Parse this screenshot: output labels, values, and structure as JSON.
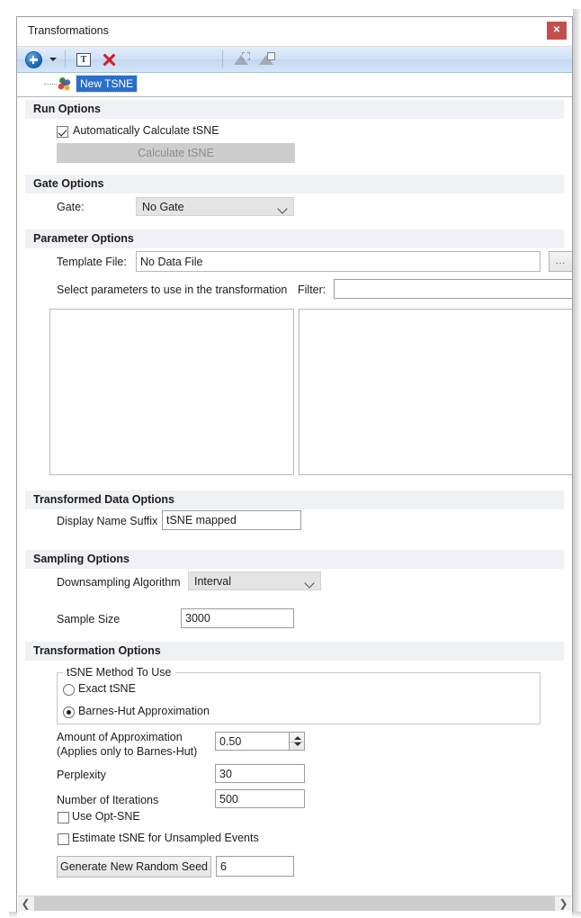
{
  "window": {
    "title": "Transformations",
    "close_label": "✕"
  },
  "toolbar": {
    "add_icon": "plus-circle-icon",
    "add_dropdown_icon": "caret-down-icon",
    "rename_icon": "text-tool-icon",
    "rename_label": "T",
    "delete_icon": "red-x-icon",
    "apply_icon": "apply-to-sample-icon",
    "apply_all_icon": "apply-to-all-icon"
  },
  "tree": {
    "node_icon": "tsne-node-icon",
    "node_label": "New TSNE"
  },
  "sections": {
    "run_options": {
      "title": "Run Options",
      "auto_calc_label": "Automatically Calculate tSNE",
      "auto_calc_checked": true,
      "calculate_button": "Calculate tSNE",
      "calculate_disabled": true
    },
    "gate_options": {
      "title": "Gate Options",
      "gate_label": "Gate:",
      "gate_value": "No Gate"
    },
    "parameter_options": {
      "title": "Parameter Options",
      "template_file_label": "Template File:",
      "template_file_value": "No Data File",
      "browse_button": "...",
      "select_params_label": "Select parameters to use in the transformation",
      "filter_label": "Filter:",
      "filter_value": "",
      "available_list": [],
      "selected_list": []
    },
    "transformed_data_options": {
      "title": "Transformed Data Options",
      "display_name_suffix_label": "Display Name Suffix",
      "display_name_suffix_value": "tSNE mapped"
    },
    "sampling_options": {
      "title": "Sampling Options",
      "downsampling_label": "Downsampling Algorithm",
      "downsampling_value": "Interval",
      "sample_size_label": "Sample Size",
      "sample_size_value": "3000"
    },
    "transformation_options": {
      "title": "Transformation Options",
      "method_group_title": "tSNE Method To Use",
      "method_exact_label": "Exact tSNE",
      "method_exact_selected": false,
      "method_barnes_label": "Barnes-Hut Approximation",
      "method_barnes_selected": true,
      "approx_label_line1": "Amount of Approximation",
      "approx_label_line2": "(Applies only to Barnes-Hut)",
      "approx_value": "0.50",
      "perplexity_label": "Perplexity",
      "perplexity_value": "30",
      "iterations_label": "Number of Iterations",
      "iterations_value": "500",
      "use_opt_sne_label": "Use Opt-SNE",
      "use_opt_sne_checked": false,
      "estimate_unsampled_label": "Estimate tSNE for Unsampled Events",
      "estimate_unsampled_checked": false,
      "generate_seed_button": "Generate New Random Seed",
      "seed_value": "6"
    }
  },
  "scrollbar": {
    "left_arrow": "❮",
    "right_arrow": "❯"
  },
  "colors": {
    "accent_blue": "#2a6fc9",
    "close_red": "#c0504d",
    "delete_red": "#cf2026",
    "section_band": "#f0f1f5"
  }
}
